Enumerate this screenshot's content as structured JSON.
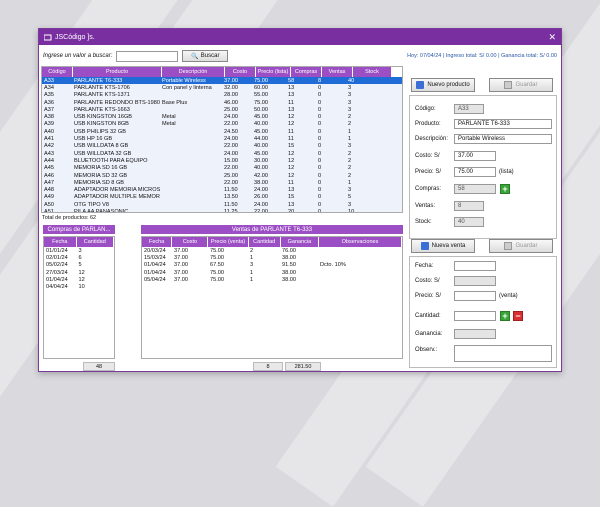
{
  "window": {
    "title": "JSCódigo ]s."
  },
  "search": {
    "label": "Ingrese un valor a buscar:",
    "value": "",
    "button": "Buscar"
  },
  "status": "Hoy: 07/04/24  |  Ingreso total: S/ 0.00  |  Ganancia total: S/ 0.00",
  "products": {
    "headers": [
      "Código",
      "Producto",
      "Descripción",
      "Costo",
      "Precio (lista)",
      "Compras",
      "Ventas",
      "Stock"
    ],
    "rows": [
      [
        "A33",
        "PARLANTE T6-333",
        "Portable Wireless",
        "37.00",
        "75.00",
        "58",
        "8",
        "40"
      ],
      [
        "A34",
        "PARLANTE KTS-1706",
        "Con panel y linterna",
        "32.00",
        "60.00",
        "13",
        "0",
        "3"
      ],
      [
        "A35",
        "PARLANTE KTS-1371",
        "",
        "28.00",
        "55.00",
        "13",
        "0",
        "3"
      ],
      [
        "A36",
        "PARLANTE REDONDO BTS-1980",
        "Base Plus",
        "46.00",
        "75.00",
        "11",
        "0",
        "3"
      ],
      [
        "A37",
        "PARLANTE KTS-1663",
        "",
        "25.00",
        "50.00",
        "13",
        "0",
        "3"
      ],
      [
        "A38",
        "USB KINGSTON 16GB",
        "Metal",
        "24.00",
        "45.00",
        "12",
        "0",
        "2"
      ],
      [
        "A39",
        "USB KINGSTON 8GB",
        "Metal",
        "22.00",
        "40.00",
        "12",
        "0",
        "2"
      ],
      [
        "A40",
        "USB PHILIPS 32 GB",
        "",
        "24.50",
        "45.00",
        "11",
        "0",
        "1"
      ],
      [
        "A41",
        "USB HP 16 GB",
        "",
        "24.00",
        "44.00",
        "11",
        "0",
        "1"
      ],
      [
        "A42",
        "USB WILLDATA 8 GB",
        "",
        "22.00",
        "40.00",
        "15",
        "0",
        "3"
      ],
      [
        "A43",
        "USB WILLDATA 32 GB",
        "",
        "24.00",
        "45.00",
        "12",
        "0",
        "2"
      ],
      [
        "A44",
        "BLUETOOTH PARA EQUIPO",
        "",
        "15.00",
        "30.00",
        "12",
        "0",
        "2"
      ],
      [
        "A45",
        "MEMORIA SD 16 GB",
        "",
        "22.00",
        "40.00",
        "12",
        "0",
        "2"
      ],
      [
        "A46",
        "MEMORIA SD 32 GB",
        "",
        "25.00",
        "42.00",
        "12",
        "0",
        "2"
      ],
      [
        "A47",
        "MEMORIA SD 8 GB",
        "",
        "22.00",
        "38.00",
        "11",
        "0",
        "1"
      ],
      [
        "A48",
        "ADAPTADOR MEMORIA MICROS",
        "",
        "11.50",
        "24.00",
        "13",
        "0",
        "3"
      ],
      [
        "A49",
        "ADAPTADOR MULTIPLE MEMORI",
        "",
        "13.50",
        "26.00",
        "15",
        "0",
        "5"
      ],
      [
        "A50",
        "OTG TIPO V8",
        "",
        "11.50",
        "24.00",
        "13",
        "0",
        "3"
      ],
      [
        "A51",
        "PILA AA PANASONIC",
        "",
        "11.25",
        "22.00",
        "20",
        "0",
        "10"
      ]
    ],
    "total": "Total de productos: 62"
  },
  "purchases": {
    "title": "Compras de PARLAN...",
    "headers": [
      "Fecha",
      "Cantidad"
    ],
    "rows": [
      [
        "01/01/24",
        "3"
      ],
      [
        "02/01/24",
        "6"
      ],
      [
        "05/02/24",
        "5"
      ],
      [
        "27/03/24",
        "12"
      ],
      [
        "01/04/24",
        "12"
      ],
      [
        "04/04/24",
        "10"
      ]
    ],
    "sum": "48"
  },
  "sales": {
    "title": "Ventas de PARLANTE T6-333",
    "headers": [
      "Fecha",
      "Costo",
      "Precio (venta)",
      "Cantidad",
      "Ganancia",
      "Observaciones"
    ],
    "rows": [
      [
        "20/03/24",
        "37.00",
        "75.00",
        "2",
        "76.00",
        ""
      ],
      [
        "15/03/24",
        "37.00",
        "75.00",
        "1",
        "38.00",
        ""
      ],
      [
        "01/04/24",
        "37.00",
        "67.50",
        "3",
        "91.50",
        "Dcto. 10%"
      ],
      [
        "01/04/24",
        "37.00",
        "75.00",
        "1",
        "38.00",
        ""
      ],
      [
        "05/04/24",
        "37.00",
        "75.00",
        "1",
        "38.00",
        ""
      ]
    ],
    "sum_qty": "8",
    "sum_profit": "281.50"
  },
  "product_form": {
    "new_btn": "Nuevo producto",
    "save_btn": "Guardar",
    "code_label": "Código:",
    "code": "A33",
    "name_label": "Producto:",
    "name": "PARLANTE T6-333",
    "desc_label": "Descripción:",
    "desc": "Portable Wireless",
    "cost_label": "Costo: S/",
    "cost": "37.00",
    "price_label": "Precio: S/",
    "price": "75.00",
    "price_suffix": "(lista)",
    "buys_label": "Compras:",
    "buys": "58",
    "sales_label": "Ventas:",
    "sales": "8",
    "stock_label": "Stock:",
    "stock": "40"
  },
  "sale_form": {
    "new_btn": "Nueva venta",
    "save_btn": "Guardar",
    "date_label": "Fecha:",
    "cost_label": "Costo: S/",
    "price_label": "Precio: S/",
    "price_suffix": "(venta)",
    "qty_label": "Cantidad:",
    "profit_label": "Ganancia:",
    "obs_label": "Observ.:"
  }
}
